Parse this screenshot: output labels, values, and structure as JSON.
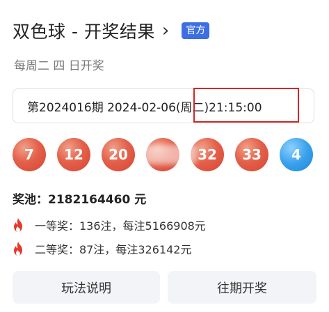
{
  "header": {
    "title": "双色球 - 开奖结果",
    "chevron": "›",
    "badge": "官方"
  },
  "schedule": "每周二 四 日开奖",
  "draw_selector": {
    "value": "第2024016期 2024-02-06(周二)21:15:00"
  },
  "balls": {
    "red": [
      "7",
      "12",
      "20",
      "",
      "32",
      "33"
    ],
    "blue": "4",
    "red_color": "#e4604a",
    "blue_color": "#3aa2ec",
    "note": "4th red ball obscured"
  },
  "pool": {
    "text": "奖池：2182164460 元"
  },
  "prizes": [
    {
      "icon": "fire-icon",
      "text": "一等奖：136注，每注5166908元"
    },
    {
      "icon": "fire-icon",
      "text": "二等奖：87注，每注326142元"
    }
  ],
  "buttons": {
    "rules": "玩法说明",
    "history": "往期开奖"
  },
  "colors": {
    "accent": "#3d6fe3",
    "highlight_box": "#d32626"
  }
}
